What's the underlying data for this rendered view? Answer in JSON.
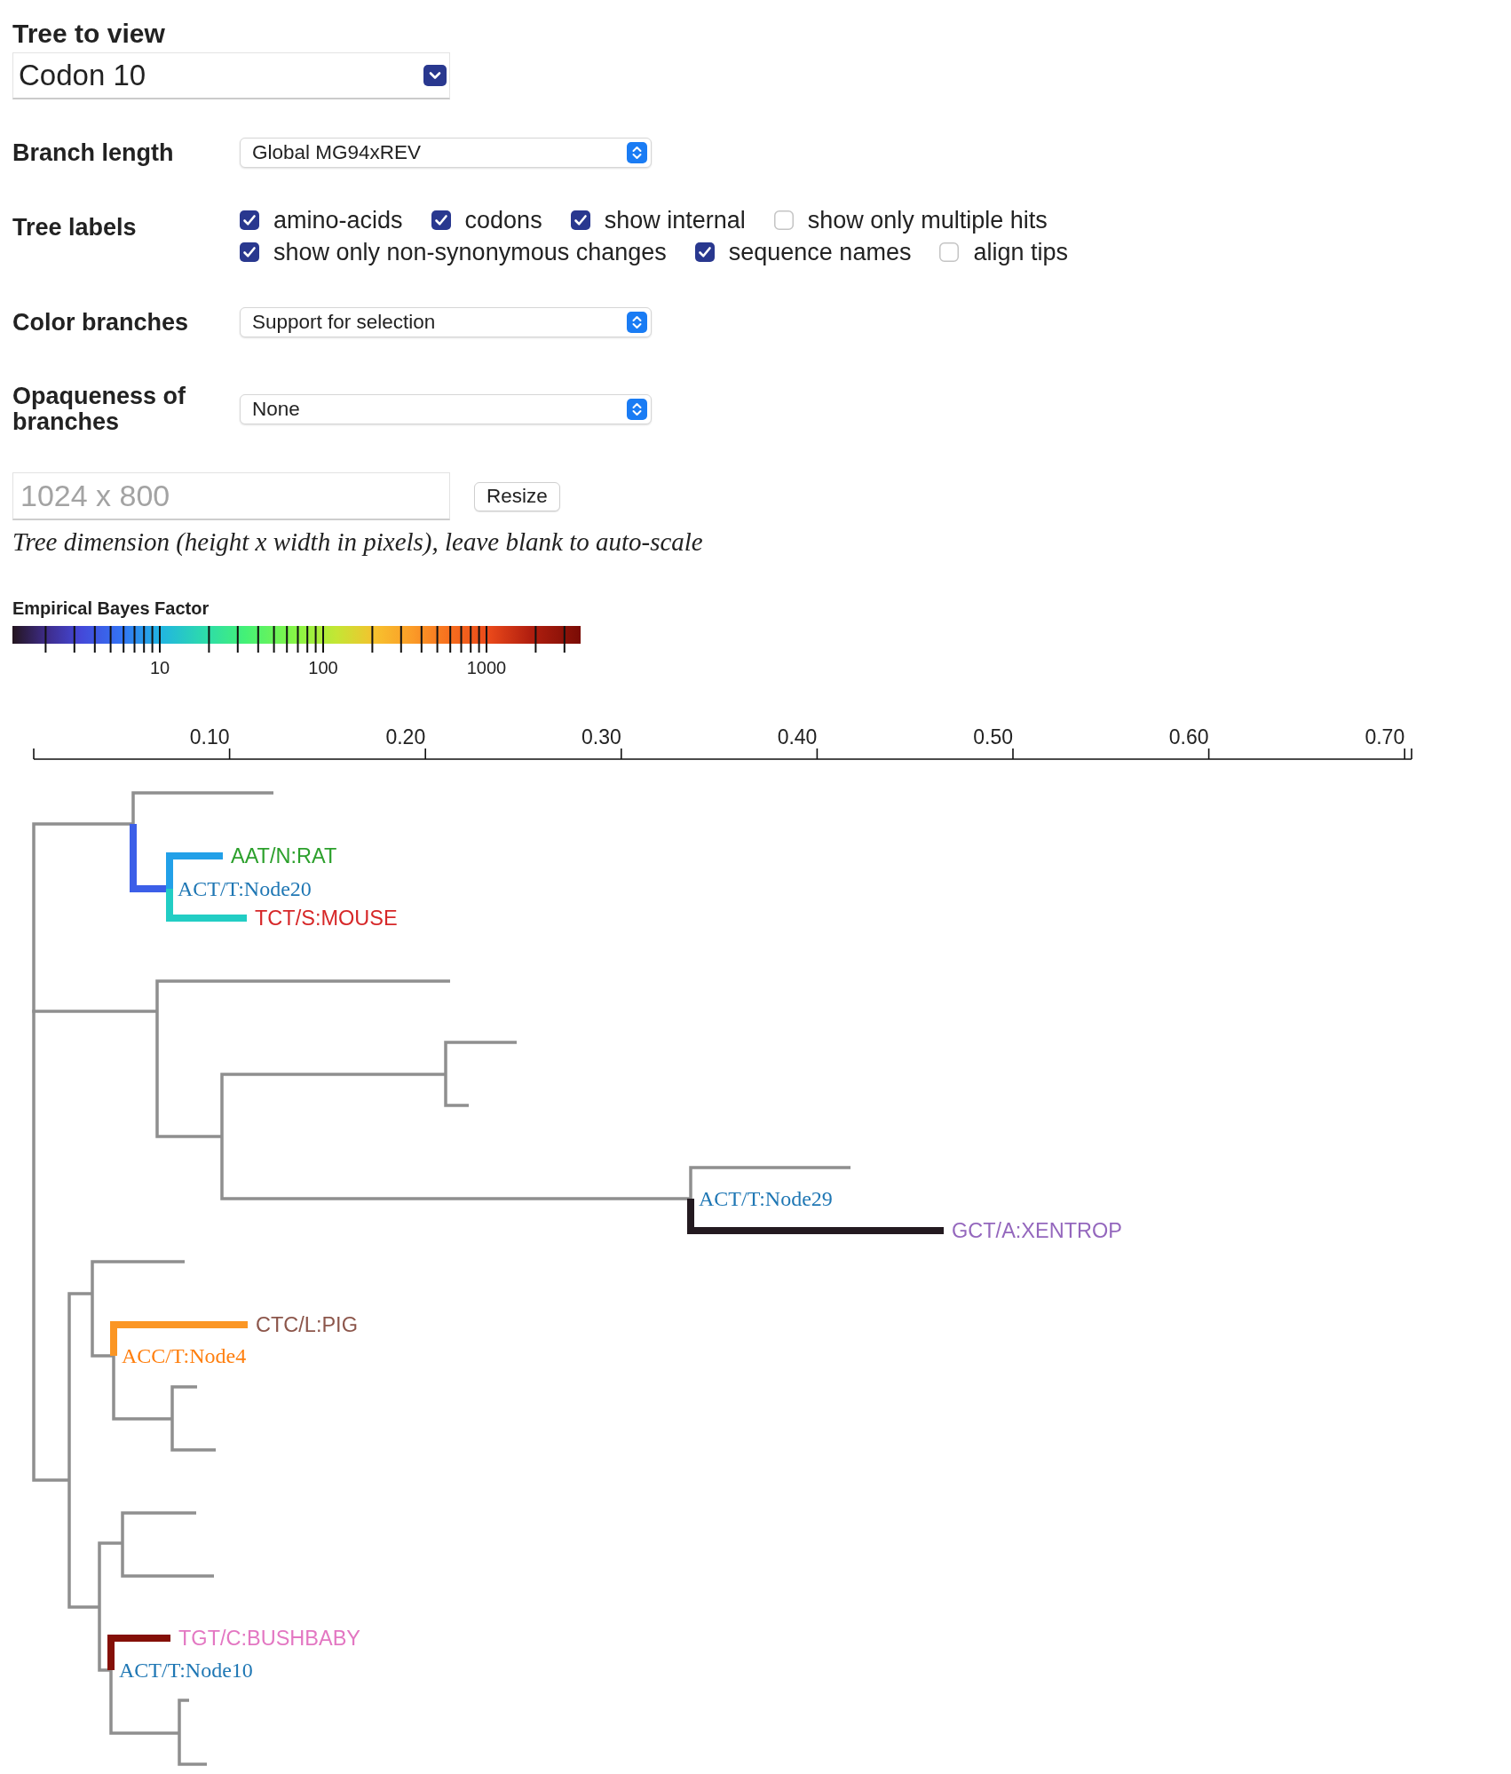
{
  "tree_to_view": {
    "label": "Tree to view",
    "value": "Codon 10"
  },
  "settings": [
    {
      "kind": "dropdown",
      "label": "Branch length",
      "value": "Global MG94xREV"
    },
    {
      "kind": "checkboxes",
      "label": "Tree labels",
      "options": [
        {
          "label": "amino-acids",
          "checked": true
        },
        {
          "label": "codons",
          "checked": true
        },
        {
          "label": "show internal",
          "checked": true
        },
        {
          "label": "show only multiple hits",
          "checked": false
        },
        {
          "label": "show only non-synonymous changes",
          "checked": true
        },
        {
          "label": "sequence names",
          "checked": true
        },
        {
          "label": "align tips",
          "checked": false
        }
      ]
    },
    {
      "kind": "dropdown",
      "label": "Color branches",
      "value": "Support for selection"
    },
    {
      "kind": "dropdown",
      "label": "Opaqueness of branches",
      "value": "None"
    }
  ],
  "size": {
    "placeholder": "1024 x 800",
    "button": "Resize",
    "hint": "Tree dimension (height x width in pixels), leave blank to auto-scale"
  },
  "legend": {
    "title": "Empirical Bayes Factor",
    "tick_labels": [
      "10",
      "100",
      "1000"
    ]
  },
  "tree": {
    "axis": {
      "tick_labels": [
        "0.10",
        "0.20",
        "0.30",
        "0.40",
        "0.50",
        "0.60",
        "0.70"
      ]
    },
    "children": [
      {
        "highlighted": false,
        "children": [
          {
            "highlighted": false
          },
          {
            "highlighted": true,
            "color": "#3c5fe8",
            "label": {
              "text": "ACT/T:Node20",
              "color": "#1f77b4"
            },
            "children": [
              {
                "highlighted": true,
                "color": "#22a0e8",
                "label": {
                  "text": "AAT/N:RAT",
                  "color": "#2ca02c"
                }
              },
              {
                "highlighted": true,
                "color": "#22cdc4",
                "label": {
                  "text": "TCT/S:MOUSE",
                  "color": "#d62728"
                }
              }
            ]
          }
        ]
      },
      {
        "highlighted": false,
        "children": [
          {
            "highlighted": false
          },
          {
            "highlighted": false,
            "children": [
              {
                "highlighted": false,
                "children": [
                  {
                    "highlighted": false
                  },
                  {
                    "highlighted": false
                  }
                ]
              },
              {
                "highlighted": false,
                "label": {
                  "text": "ACT/T:Node29",
                  "color": "#1f77b4"
                },
                "children": [
                  {
                    "highlighted": false
                  },
                  {
                    "highlighted": true,
                    "color": "#231a20",
                    "label": {
                      "text": "GCT/A:XENTROP",
                      "color": "#9467bd"
                    }
                  }
                ]
              }
            ]
          }
        ]
      },
      {
        "highlighted": false,
        "children": [
          {
            "highlighted": false,
            "children": [
              {
                "highlighted": false
              },
              {
                "highlighted": false,
                "label": {
                  "text": "ACC/T:Node4",
                  "color": "#ff7f0e"
                },
                "children": [
                  {
                    "highlighted": true,
                    "color": "#fb9624",
                    "label": {
                      "text": "CTC/L:PIG",
                      "color": "#8c564b"
                    }
                  },
                  {
                    "highlighted": false,
                    "children": [
                      {
                        "highlighted": false
                      },
                      {
                        "highlighted": false
                      }
                    ]
                  }
                ]
              }
            ]
          },
          {
            "highlighted": false,
            "children": [
              {
                "highlighted": false,
                "children": [
                  {
                    "highlighted": false
                  },
                  {
                    "highlighted": false
                  }
                ]
              },
              {
                "highlighted": false,
                "label": {
                  "text": "ACT/T:Node10",
                  "color": "#1f77b4"
                },
                "children": [
                  {
                    "highlighted": true,
                    "color": "#841007",
                    "label": {
                      "text": "TGT/C:BUSHBABY",
                      "color": "#e377c2"
                    }
                  },
                  {
                    "highlighted": false,
                    "children": [
                      {
                        "highlighted": false
                      },
                      {
                        "highlighted": false
                      }
                    ]
                  }
                ]
              }
            ]
          }
        ]
      }
    ]
  }
}
